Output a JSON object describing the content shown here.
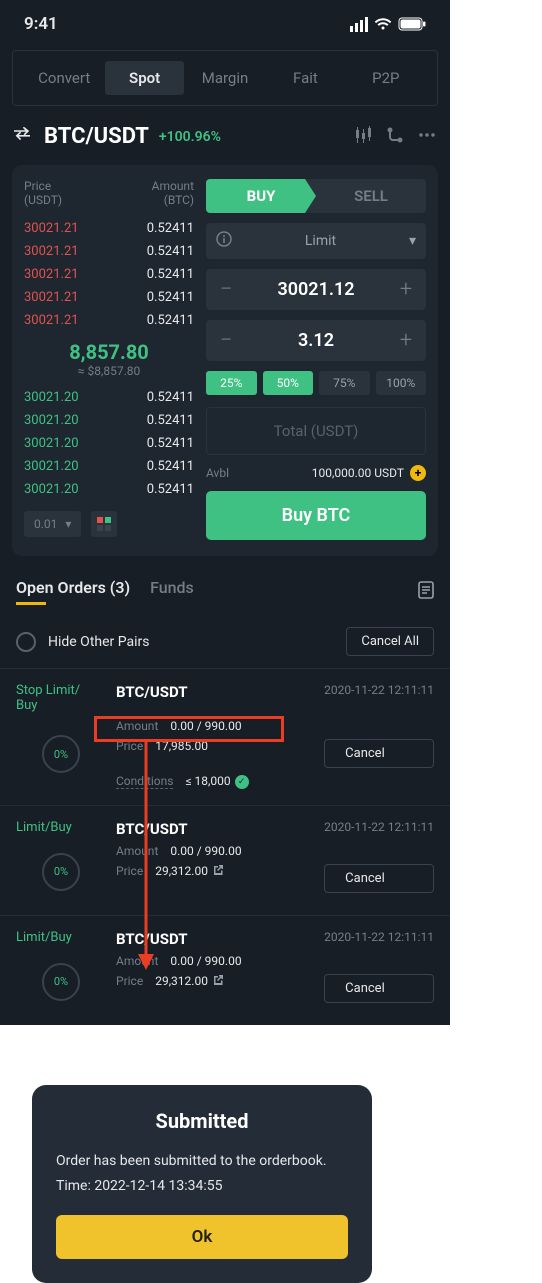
{
  "status": {
    "time": "9:41"
  },
  "tabs": [
    "Convert",
    "Spot",
    "Margin",
    "Fait",
    "P2P"
  ],
  "active_tab": "Spot",
  "pair": "BTC/USDT",
  "change": "+100.96%",
  "orderbook": {
    "price_label": "Price\n(USDT)",
    "amount_label": "Amount\n(BTC)",
    "asks": [
      {
        "p": "30021.21",
        "a": "0.52411"
      },
      {
        "p": "30021.21",
        "a": "0.52411"
      },
      {
        "p": "30021.21",
        "a": "0.52411"
      },
      {
        "p": "30021.21",
        "a": "0.52411"
      },
      {
        "p": "30021.21",
        "a": "0.52411"
      }
    ],
    "mid_price": "8,857.80",
    "mid_fiat": "≈ $8,857.80",
    "bids": [
      {
        "p": "30021.20",
        "a": "0.52411"
      },
      {
        "p": "30021.20",
        "a": "0.52411"
      },
      {
        "p": "30021.20",
        "a": "0.52411"
      },
      {
        "p": "30021.20",
        "a": "0.52411"
      },
      {
        "p": "30021.20",
        "a": "0.52411"
      }
    ],
    "tick": "0.01"
  },
  "form": {
    "buy_label": "BUY",
    "sell_label": "SELL",
    "order_type": "Limit",
    "price": "30021.12",
    "amount": "3.12",
    "pcts": [
      "25%",
      "50%",
      "75%",
      "100%"
    ],
    "total_placeholder": "Total (USDT)",
    "avbl_label": "Avbl",
    "avbl_value": "100,000.00 USDT",
    "submit": "Buy BTC"
  },
  "orders_tabs": {
    "open": "Open Orders (3)",
    "funds": "Funds"
  },
  "hide_label": "Hide Other Pairs",
  "cancel_all": "Cancel All",
  "orders": [
    {
      "type": "Stop Limit/\nBuy",
      "pair": "BTC/USDT",
      "ts": "2020-11-22  12:11:11",
      "pct": "0%",
      "rows": [
        {
          "k": "Amount",
          "v": "0.00 / 990.00"
        },
        {
          "k": "Price",
          "v": "17,985.00"
        },
        {
          "k": "Conditions",
          "v": "≤ 18,000",
          "cond": true
        }
      ],
      "cancel": "Cancel"
    },
    {
      "type": "Limit/Buy",
      "pair": "BTC/USDT",
      "ts": "2020-11-22  12:11:11",
      "pct": "0%",
      "rows": [
        {
          "k": "Amount",
          "v": "0.00 / 990.00"
        },
        {
          "k": "Price",
          "v": "29,312.00",
          "ext": true
        }
      ],
      "cancel": "Cancel"
    },
    {
      "type": "Limit/Buy",
      "pair": "BTC/USDT",
      "ts": "2020-11-22  12:11:11",
      "pct": "0%",
      "rows": [
        {
          "k": "Amount",
          "v": "0.00 / 990.00"
        },
        {
          "k": "Price",
          "v": "29,312.00",
          "ext": true
        }
      ],
      "cancel": "Cancel"
    }
  ],
  "modal": {
    "title": "Submitted",
    "body": "Order has been submitted to the orderbook.",
    "time": "Time: 2022-12-14 13:34:55",
    "ok": "Ok"
  }
}
